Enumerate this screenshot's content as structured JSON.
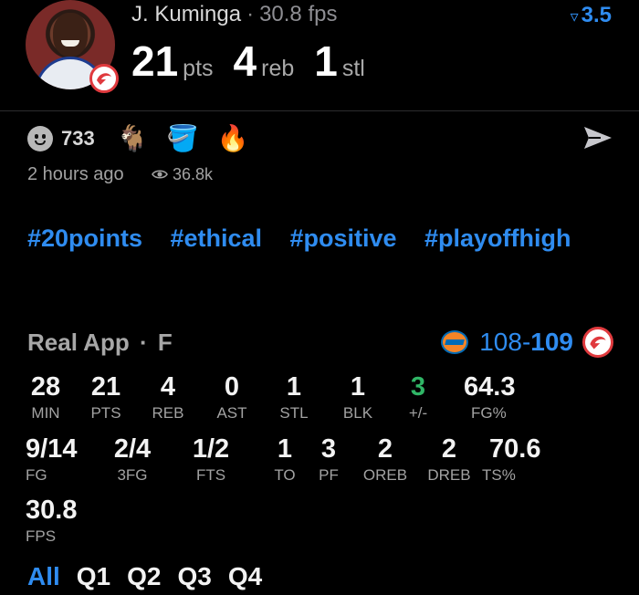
{
  "player": {
    "name": "J. Kuminga",
    "separator": "·",
    "fps": "30.8 fps",
    "version_badge": "3.5",
    "stats": [
      {
        "value": "21",
        "unit": "pts"
      },
      {
        "value": "4",
        "unit": "reb"
      },
      {
        "value": "1",
        "unit": "stl"
      }
    ]
  },
  "post": {
    "reaction_count": "733",
    "emojis": [
      "🐐",
      "🪣",
      "🔥"
    ],
    "time_ago": "2 hours ago",
    "views": "36.8k",
    "tags": [
      "#20points",
      "#ethical",
      "#positive",
      "#playoffhigh"
    ]
  },
  "game": {
    "label": "Real App",
    "separator": "·",
    "position": "F",
    "score_home": "108",
    "score_dash": "-",
    "score_away": "109"
  },
  "boxscore": {
    "row1": [
      {
        "value": "28",
        "label": "MIN"
      },
      {
        "value": "21",
        "label": "PTS"
      },
      {
        "value": "4",
        "label": "REB"
      },
      {
        "value": "0",
        "label": "AST"
      },
      {
        "value": "1",
        "label": "STL"
      },
      {
        "value": "1",
        "label": "BLK"
      },
      {
        "value": "3",
        "label": "+/-"
      },
      {
        "value": "64.3",
        "label": "FG%"
      }
    ],
    "row2": [
      {
        "value": "9/14",
        "label": "FG"
      },
      {
        "value": "2/4",
        "label": "3FG"
      },
      {
        "value": "1/2",
        "label": "FTS"
      },
      {
        "value": "1",
        "label": "TO"
      },
      {
        "value": "3",
        "label": "PF"
      },
      {
        "value": "2",
        "label": "OREB"
      },
      {
        "value": "2",
        "label": "DREB"
      },
      {
        "value": "70.6",
        "label": "TS%"
      }
    ],
    "row3": [
      {
        "value": "30.8",
        "label": "FPS"
      }
    ]
  },
  "tabs": [
    "All",
    "Q1",
    "Q2",
    "Q3",
    "Q4"
  ],
  "colors": {
    "accent": "#2f8cf0",
    "positive": "#30b566",
    "background": "#000000"
  },
  "icons": {
    "reaction": "smiley-icon",
    "send": "send-icon",
    "views": "eye-icon",
    "version": "caret-down-icon"
  }
}
